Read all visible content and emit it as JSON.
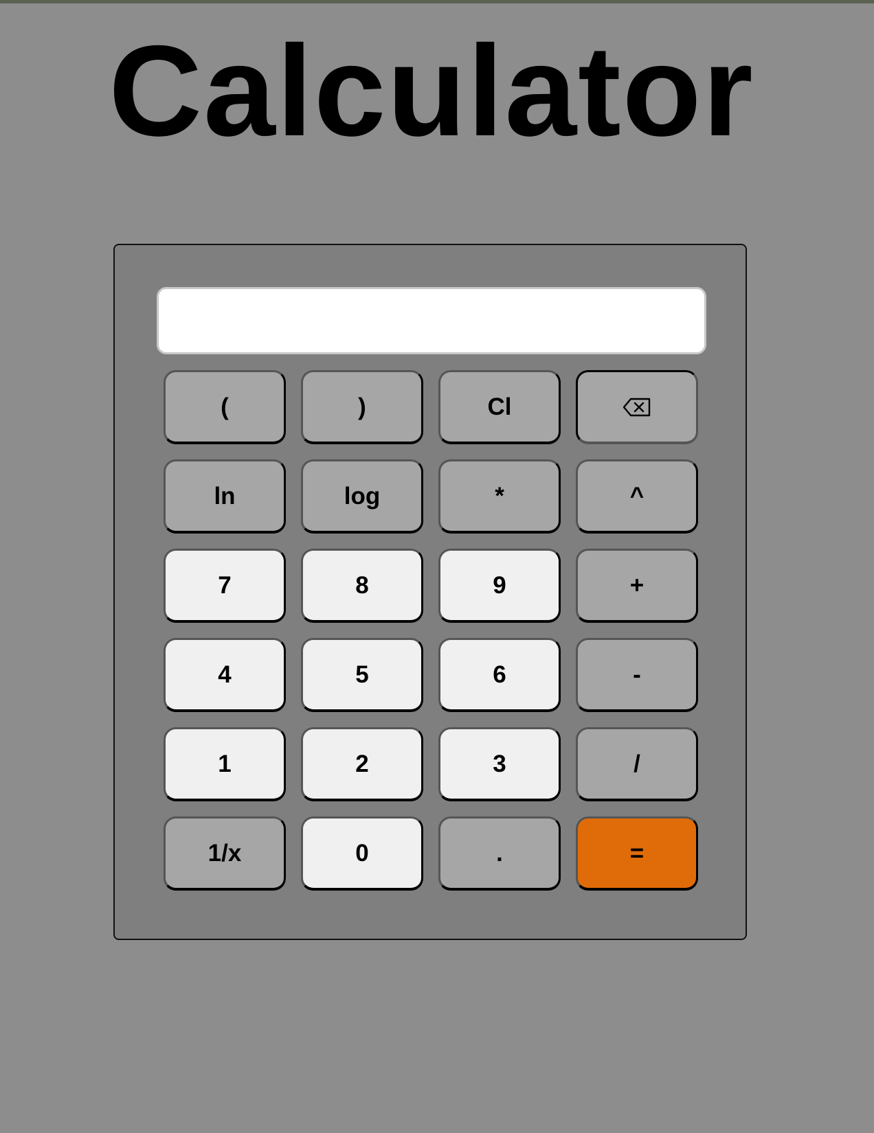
{
  "page": {
    "title": "Calculator"
  },
  "display": {
    "value": "",
    "placeholder": ""
  },
  "keys": {
    "open_paren": "(",
    "close_paren": ")",
    "clear": "Cl",
    "backspace_icon": "backspace-icon",
    "ln": "ln",
    "log": "log",
    "multiply": "*",
    "power": "^",
    "seven": "7",
    "eight": "8",
    "nine": "9",
    "plus": "+",
    "four": "4",
    "five": "5",
    "six": "6",
    "minus": "-",
    "one": "1",
    "two": "2",
    "three": "3",
    "divide": "/",
    "reciprocal": "1/x",
    "zero": "0",
    "decimal": ".",
    "equals": "="
  },
  "colors": {
    "page_background": "#8e8d8e",
    "calculator_body": "#7f7f7f",
    "operator_key": "#a6a6a6",
    "number_key": "#f0f0f0",
    "equals_key": "#e06c09",
    "display_background": "#ffffff"
  }
}
